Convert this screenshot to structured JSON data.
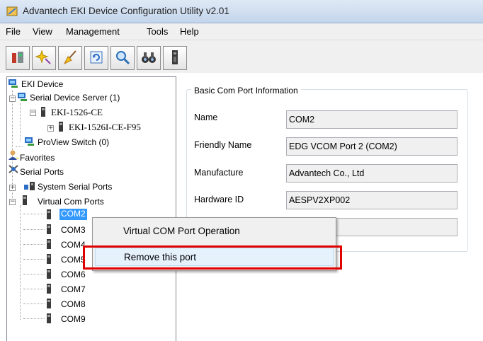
{
  "window": {
    "title": "Advantech EKI Device Configuration Utility v2.01"
  },
  "menubar": {
    "items": [
      "File",
      "View",
      "Management",
      "Tools",
      "Help"
    ]
  },
  "toolbar": {
    "buttons": [
      "device-icon",
      "sparkle-icon",
      "broom-icon",
      "refresh-icon",
      "search-icon",
      "binoculars-icon",
      "serial-port-icon"
    ]
  },
  "tree": {
    "root": "EKI Device",
    "serial_device_server": "Serial Device Server (1)",
    "eki_1526_ce": "EKI-1526-CE",
    "eki_1526i": "EKI-1526I-CE-F95",
    "proview_switch": "ProView Switch (0)",
    "favorites": "Favorites",
    "serial_ports": "Serial Ports",
    "system_serial_ports": "System Serial Ports",
    "virtual_com_ports": "Virtual Com Ports",
    "com_ports": [
      "COM2",
      "COM3",
      "COM4",
      "COM5",
      "COM6",
      "COM7",
      "COM8",
      "COM9"
    ],
    "selected": "COM2"
  },
  "info": {
    "group_title": "Basic Com Port Information",
    "fields": [
      {
        "label": "Name",
        "value": "COM2"
      },
      {
        "label": "Friendly Name",
        "value": "EDG VCOM Port 2 (COM2)"
      },
      {
        "label": "Manufacture",
        "value": "Advantech Co., Ltd"
      },
      {
        "label": "Hardware ID",
        "value": "AESPV2XP002"
      },
      {
        "label": "",
        "value": ""
      }
    ]
  },
  "context_menu": {
    "items": [
      "Virtual COM Port Operation",
      "Remove this port"
    ],
    "highlighted": "Remove this port"
  },
  "colors": {
    "selection": "#3399ff",
    "annotation_box": "#e00000"
  }
}
